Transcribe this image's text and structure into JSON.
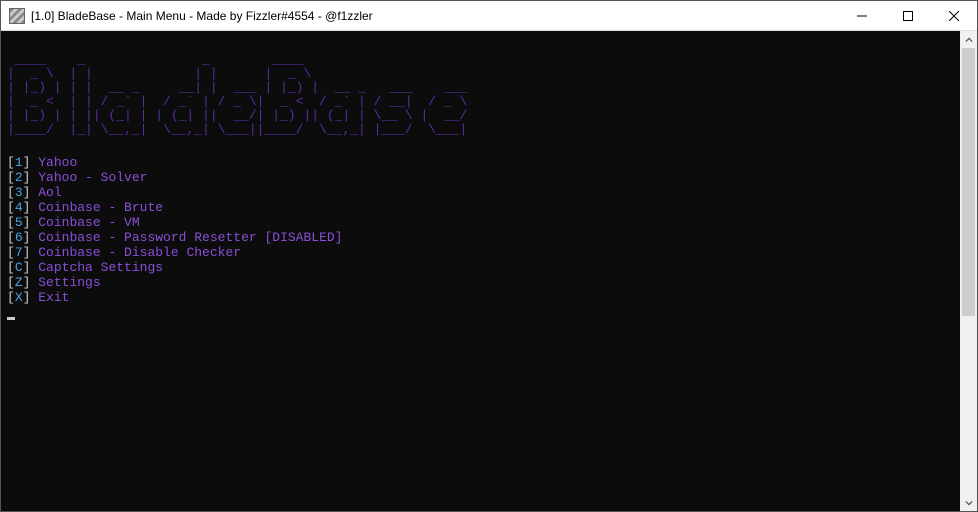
{
  "window": {
    "title": "[1.0] BladeBase - Main Menu - Made by Fizzler#4554 - @f1zzler"
  },
  "ascii_art": " ____    _               _        ____                         \n|  _ \\  | |             | |      |  _ \\                        \n| |_) | | |  __ _     __| |  ___ | |_) |  __ _   ___    ___    \n|  _ <  | | / _` |  / _` | / _ \\|  _ <  / _` | / __|  / _ \\   \n| |_) | | || (_| | | (_| ||  __/| |_) || (_| | \\__ \\ |  __/   \n|____/  |_| \\__,_|  \\__,_| \\___||____/  \\__,_| |___/  \\___|   ",
  "menu": [
    {
      "key": "1",
      "label": "Yahoo"
    },
    {
      "key": "2",
      "label": "Yahoo - Solver"
    },
    {
      "key": "3",
      "label": "Aol"
    },
    {
      "key": "4",
      "label": "Coinbase - Brute"
    },
    {
      "key": "5",
      "label": "Coinbase - VM"
    },
    {
      "key": "6",
      "label": "Coinbase - Password Resetter [DISABLED]"
    },
    {
      "key": "7",
      "label": "Coinbase - Disable Checker"
    },
    {
      "key": "C",
      "label": "Captcha Settings"
    },
    {
      "key": "Z",
      "label": "Settings"
    },
    {
      "key": "X",
      "label": "Exit"
    }
  ],
  "colors": {
    "bracket": "#cccccc",
    "key": "#4aa3df",
    "label": "#8a4fd8",
    "ascii": "#5a2ca0",
    "console_bg": "#0c0c0c"
  }
}
